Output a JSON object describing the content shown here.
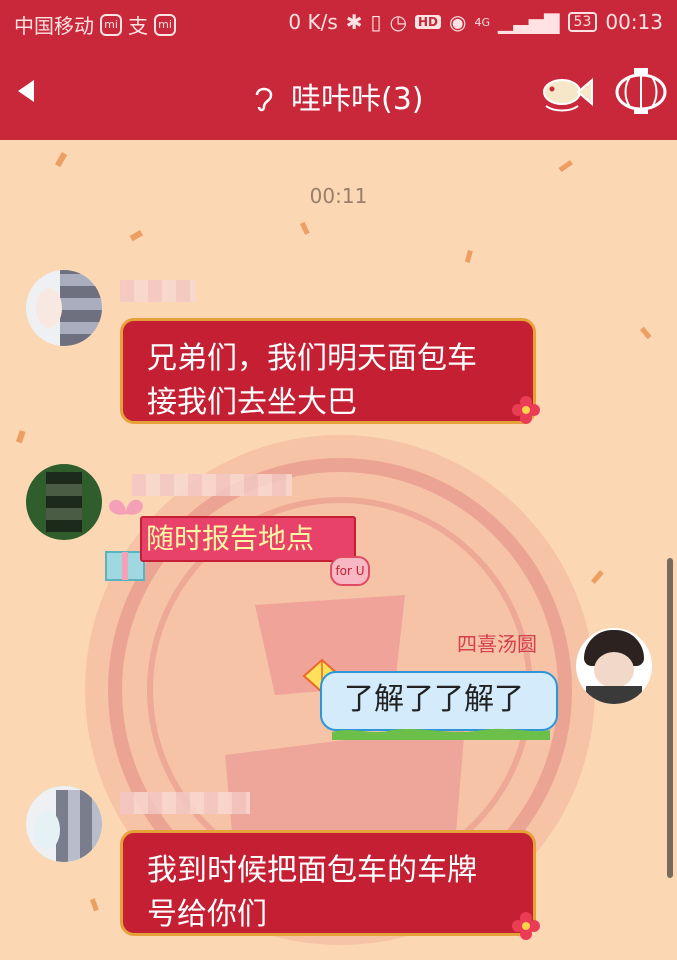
{
  "status_bar": {
    "carrier": "中国移动",
    "extra_icon_1": "mi",
    "extra_icon_2": "支",
    "extra_icon_3": "mi",
    "network_speed": "0 K/s",
    "hd": "HD",
    "network_type": "4G",
    "battery": "53",
    "time": "00:13"
  },
  "header": {
    "title": "哇咔咔(3)",
    "back_icon": "back-arrow-icon",
    "ear_icon": "ear-icon",
    "fish_icon": "fish-icon",
    "lantern_icon": "lantern-icon"
  },
  "chat": {
    "timestamp": "00:11",
    "messages": [
      {
        "side": "left",
        "text_line1": "兄弟们，我们明天面包车",
        "text_line2": "接我们去坐大巴"
      },
      {
        "side": "left",
        "text": "随时报告地点",
        "tag": "for U"
      },
      {
        "side": "right",
        "sender": "四喜汤圆",
        "text": "了解了了解了"
      },
      {
        "side": "left",
        "text_line1": "我到时候把面包车的车牌",
        "text_line2": "号给你们"
      }
    ]
  },
  "colors": {
    "header_bg": "#c8283a",
    "chat_bg": "#fbd7b3",
    "bubble_red": "#c41f33",
    "bubble_border": "#e6a13a",
    "bubble_blue": "#d3ebfa"
  }
}
